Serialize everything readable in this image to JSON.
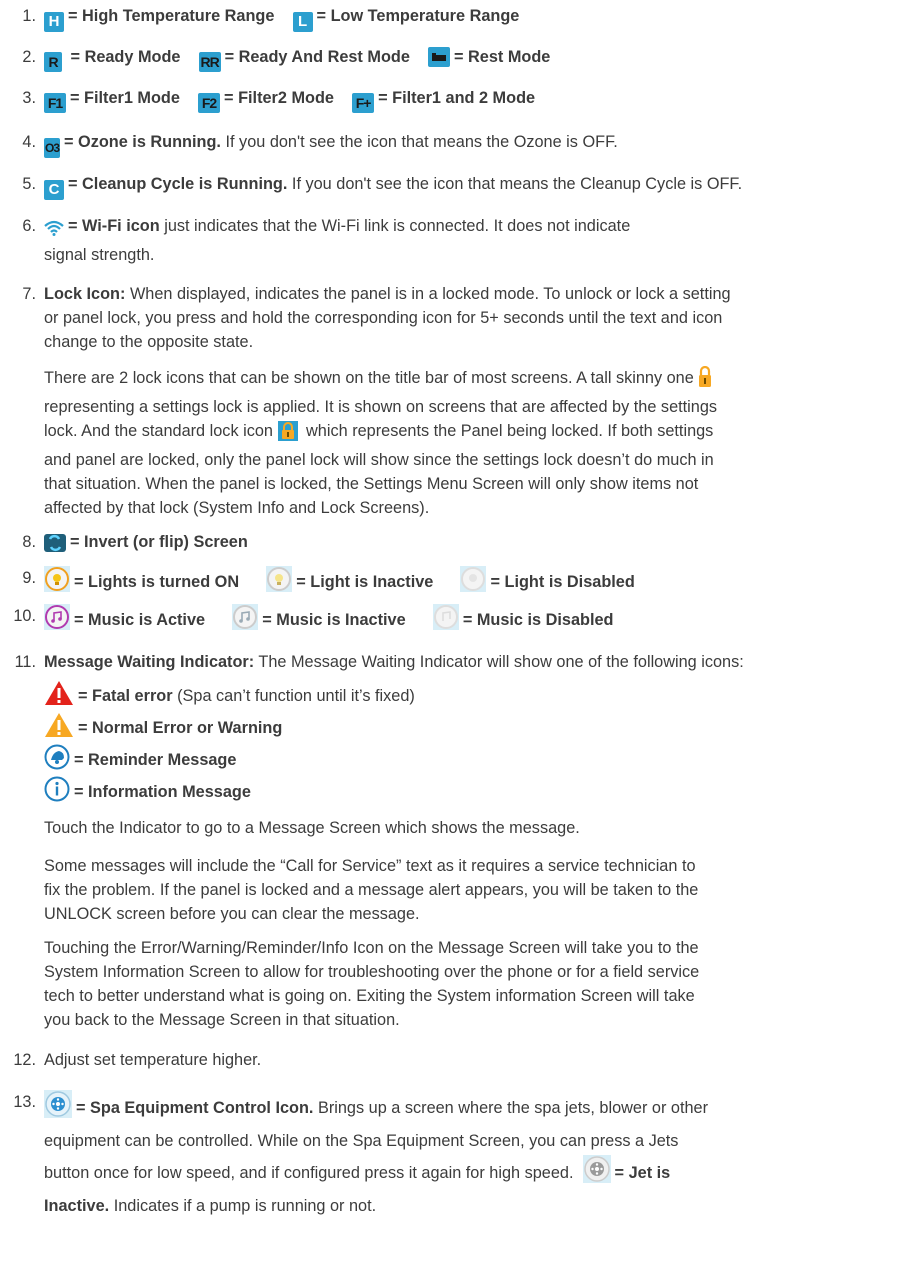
{
  "items": [
    {
      "n": "1.",
      "a1": "H",
      "t1": "= High Temperature Range",
      "a2": "L",
      "t2": "= Low Temperature Range"
    },
    {
      "n": "2.",
      "a1": "R",
      "t1": "= Ready Mode",
      "a2": "RR",
      "t2": "= Ready And Rest Mode",
      "t3": "= Rest Mode"
    },
    {
      "n": "3.",
      "a1": "F1",
      "t1": "= Filter1 Mode",
      "a2": "F2",
      "t2": "= Filter2 Mode",
      "a3": "F+",
      "t3": "= Filter1 and 2 Mode"
    },
    {
      "n": "4.",
      "a1": "O3",
      "bold": "= Ozone is Running.",
      "rest": " If you don't see the icon that means the Ozone is OFF."
    },
    {
      "n": "5.",
      "a1": "C",
      "bold": "= Cleanup Cycle is Running.",
      "rest": " If you don't see the icon that means the Cleanup Cycle is OFF."
    },
    {
      "n": "6.",
      "bold": "= Wi-Fi icon",
      "rest1": " just indicates that the Wi-Fi link is connected. It does not indicate",
      "rest2": "signal strength."
    },
    {
      "n": "7.",
      "bold": "Lock Icon:",
      "l1": " When displayed, indicates the panel is in a locked mode. To unlock or lock a setting",
      "l2": "or panel lock, you press and hold the corresponding icon for 5+ seconds until the text and icon",
      "l3": "change to the opposite state.",
      "p2l1": "There are 2 lock icons that can be shown on the title bar of most screens. A tall skinny one",
      "p2l2": "representing a settings lock is applied. It is shown on screens that are affected by the settings",
      "p2l3a": "lock. And the standard lock icon",
      "p2l3b": "which represents the Panel being locked. If both settings",
      "p2l4": "and panel are locked, only the panel lock will show since the settings lock doesn’t do much in",
      "p2l5": "that situation. When the panel is locked, the Settings Menu Screen will only show items not",
      "p2l6": "affected by that lock (System Info and Lock Screens)."
    },
    {
      "n": "8.",
      "bold": "= Invert (or flip) Screen"
    },
    {
      "n": "9.",
      "t1": "= Lights is turned ON",
      "t2": "= Light is Inactive",
      "t3": "= Light is Disabled"
    },
    {
      "n": "10.",
      "t1": "= Music is Active",
      "t2": "= Music is Inactive",
      "t3": "= Music is Disabled"
    },
    {
      "n": "11.",
      "bold": "Message Waiting Indicator:",
      "rest": " The Message Waiting Indicator will show one of the following icons:",
      "m1b": "= Fatal error",
      "m1r": " (Spa can’t function until it’s fixed)",
      "m2": "= Normal Error or Warning",
      "m3": "= Reminder Message",
      "m4": "= Information Message",
      "s1": "Touch the Indicator to go to a Message Screen which shows the message.",
      "s2l1": "Some messages will include the “Call for Service” text as it requires a service technician to",
      "s2l2": "fix the problem. If the panel is locked and a message alert appears, you will be taken to the",
      "s2l3": "UNLOCK screen before you can clear the message.",
      "s3l1": "Touching the Error/Warning/Reminder/Info Icon on the Message Screen will take you to the",
      "s3l2": "System Information Screen to allow for troubleshooting over the phone or for a field service",
      "s3l3": "tech to better understand what is going on. Exiting the System information Screen will take",
      "s3l4": "you back to the Message Screen in that situation."
    },
    {
      "n": "12.",
      "text": "Adjust set temperature higher."
    },
    {
      "n": "13.",
      "bold": "= Spa Equipment Control Icon.",
      "l1": " Brings up a screen where the spa jets, blower or other",
      "l2": "equipment can be controlled. While on the Spa Equipment Screen, you can press a Jets",
      "l3": "button once for low speed, and if configured press it again for high speed.",
      "b2": "= Jet is",
      "b3": "Inactive.",
      "l4": " Indicates if a pump is running or not."
    }
  ],
  "colors": {
    "accent": "#2c9fcf",
    "text": "#3c3c3c",
    "red": "#e3231b",
    "orange": "#f7a823"
  }
}
